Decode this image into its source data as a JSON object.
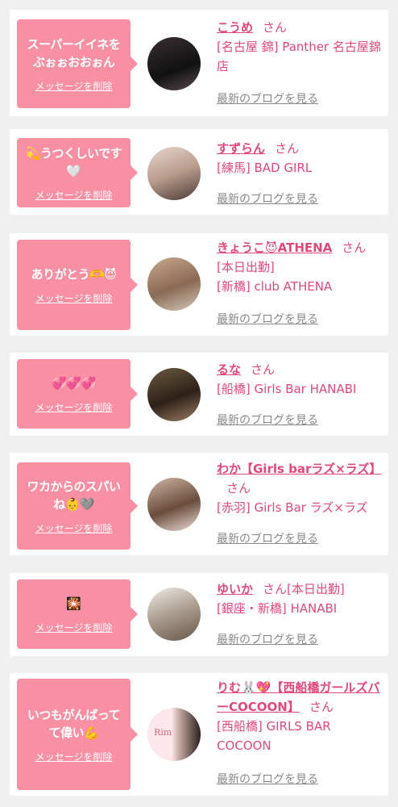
{
  "delete_label": "メッセージを削除",
  "san": "さん",
  "blog_label": "最新のブログを見る",
  "cards": [
    {
      "message": "スーパーイイネを ぶぉぉおおぉん",
      "name": "こうめ",
      "status": "",
      "shop": "[名古屋 錦] Panther 名古屋錦店"
    },
    {
      "message": "💫うつくしいです🤍",
      "name": "すずらん",
      "status": "",
      "shop": "[練馬] BAD GIRL"
    },
    {
      "message": "ありがとう🫶😈",
      "name": "きょうこ😈ATHENA",
      "status": "[本日出勤]",
      "shop": "[新橋] club ATHENA"
    },
    {
      "message": "💞💞💞",
      "name": "るな",
      "status": "",
      "shop": "[船橋] Girls Bar HANABI"
    },
    {
      "message": "ワカからのスパいね👶🩶",
      "name": "わか【Girls barラズ×ラズ】",
      "status": "",
      "shop": "[赤羽] Girls Bar ラズ×ラズ"
    },
    {
      "message": "🎇",
      "name": "ゆいか",
      "status": "[本日出勤]",
      "shop": "[銀座・新橋] HANABI"
    },
    {
      "message": "いつもがんばってて偉い💪",
      "name": "りむ🐰💖【西船橋ガールズバーCOCOON】",
      "status": "",
      "shop": "[西船橋] GIRLS BAR COCOON",
      "avatar_text": "Rim"
    }
  ],
  "colors": {
    "accent": "#f98fa3",
    "name": "#e0487a",
    "link": "#888888",
    "bg": "#f0f0f0"
  }
}
